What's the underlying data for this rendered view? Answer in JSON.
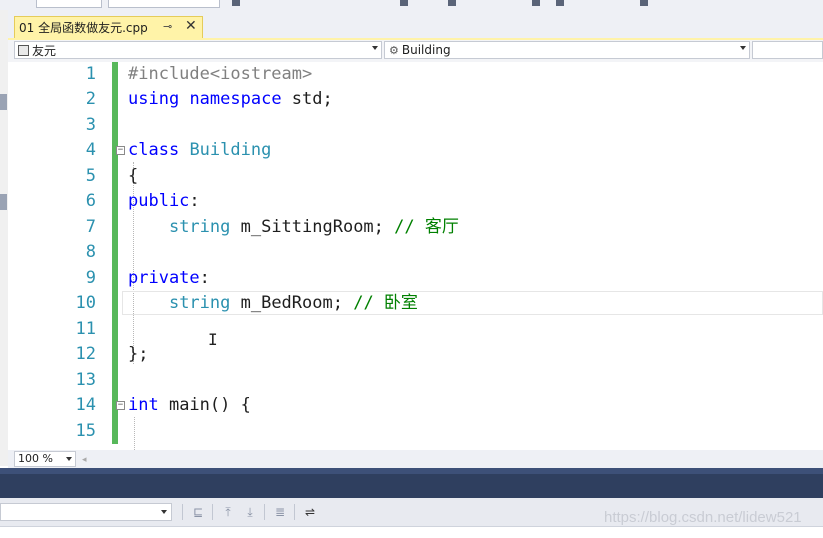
{
  "tab": {
    "title": "01 全局函数做友元.cpp",
    "pin_icon": "pin-icon",
    "close_icon": "close-icon"
  },
  "navigation": {
    "scope_dropdown": "友元",
    "member_dropdown": "Building"
  },
  "editor": {
    "line_numbers": [
      "1",
      "2",
      "3",
      "4",
      "5",
      "6",
      "7",
      "8",
      "9",
      "10",
      "11",
      "12",
      "13",
      "14",
      "15"
    ],
    "lines": [
      [
        {
          "t": "#include",
          "c": "pp"
        },
        {
          "t": "<iostream>",
          "c": "pp"
        }
      ],
      [
        {
          "t": "using",
          "c": "kw"
        },
        {
          "t": " ",
          "c": "pl"
        },
        {
          "t": "namespace",
          "c": "kw"
        },
        {
          "t": " std;",
          "c": "pl"
        }
      ],
      [],
      [
        {
          "t": "class",
          "c": "kw"
        },
        {
          "t": " ",
          "c": "pl"
        },
        {
          "t": "Building",
          "c": "ty"
        }
      ],
      [
        {
          "t": "{",
          "c": "pl"
        }
      ],
      [
        {
          "t": "public",
          "c": "kw"
        },
        {
          "t": ":",
          "c": "pl"
        }
      ],
      [
        {
          "t": "    ",
          "c": "pl"
        },
        {
          "t": "string",
          "c": "ty"
        },
        {
          "t": " m_SittingRoom; ",
          "c": "pl"
        },
        {
          "t": "// 客厅",
          "c": "cm"
        }
      ],
      [],
      [
        {
          "t": "private",
          "c": "kw"
        },
        {
          "t": ":",
          "c": "pl"
        }
      ],
      [
        {
          "t": "    ",
          "c": "pl"
        },
        {
          "t": "string",
          "c": "ty"
        },
        {
          "t": " m_BedRoom; ",
          "c": "pl"
        },
        {
          "t": "// 卧室",
          "c": "cm"
        }
      ],
      [],
      [
        {
          "t": "};",
          "c": "pl"
        }
      ],
      [],
      [
        {
          "t": "int",
          "c": "kw"
        },
        {
          "t": " main() {",
          "c": "pl"
        }
      ],
      []
    ]
  },
  "zoom": {
    "value": "100 %"
  },
  "watermark": "https://blog.csdn.net/lidew521",
  "colors": {
    "tab_active": "#fff3a8",
    "change_bar": "#57b85a",
    "keyword": "#0000ff",
    "type": "#2b91af",
    "comment": "#008000",
    "preprocessor": "#808080",
    "dark_panel": "#2f3f5f"
  }
}
